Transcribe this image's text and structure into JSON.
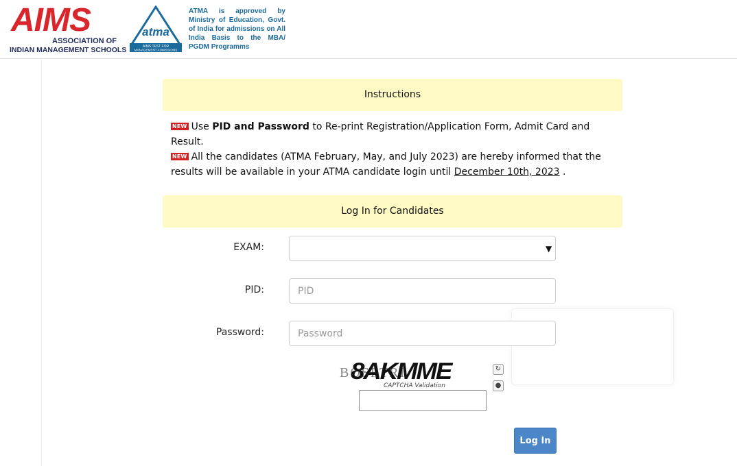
{
  "header": {
    "aims_word": "AIMS",
    "aims_sub1": "ASSOCIATION OF",
    "aims_sub2": "INDIAN MANAGEMENT SCHOOLS",
    "atma_logo_word": "atma",
    "atma_logo_caption_1": "AIMS TEST FOR",
    "atma_logo_caption_2": "MANAGEMENT ADMISSIONS",
    "approval_text": "ATMA is approved by Ministry of Education, Govt. of India for admissions on All India Basis to the MBA/ PGDM Programms"
  },
  "instructions": {
    "title": "Instructions",
    "badge": "NEW",
    "line1_pre": "Use ",
    "line1_bold": "PID and Password",
    "line1_post": " to Re-print Registration/Application Form, Admit Card and Result.",
    "line2_pre": "All the candidates (ATMA February, May, and July 2023) are hereby informed that the results will be available in your ATMA candidate login  until ",
    "line2_date": "December 10th, 2023",
    "line2_post": " ."
  },
  "login": {
    "title": "Log In for Candidates",
    "exam_label": "EXAM:",
    "exam_value": "",
    "pid_label": "PID:",
    "pid_placeholder": "PID",
    "password_label": "Password:",
    "password_placeholder": "Password",
    "captcha_text": "8AKMME",
    "captcha_noise": "BQSFTRI",
    "captcha_caption": "CAPTCHA Validation",
    "captcha_value": "",
    "button_label": "Log In"
  },
  "icons": {
    "refresh": "refresh-icon",
    "audio": "audio-icon",
    "dropdown": "chevron-down-icon"
  },
  "colors": {
    "brand_red": "#d9262c",
    "brand_navy": "#1d2a5c",
    "panel_yellow": "#fffac4",
    "button_blue": "#4a86c8",
    "approval_blue": "#1b6a9c"
  }
}
